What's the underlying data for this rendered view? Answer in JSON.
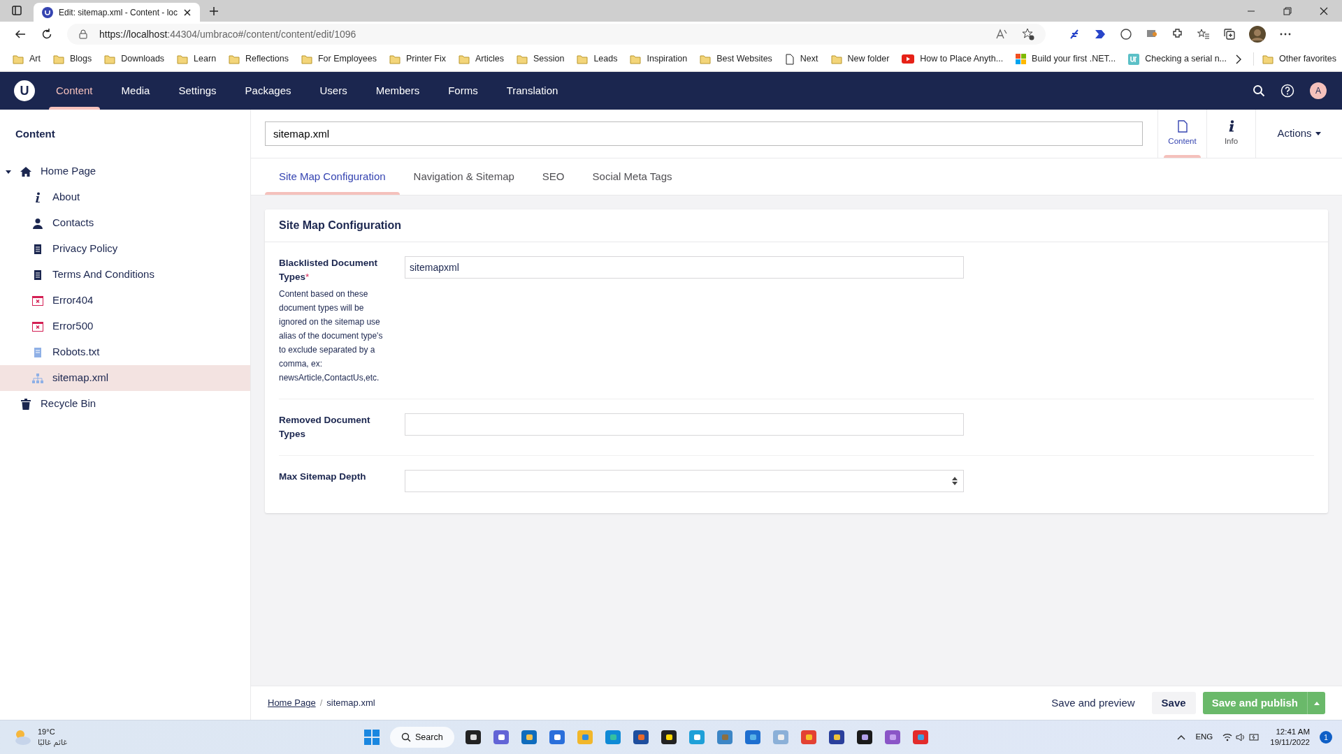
{
  "browser": {
    "tab_title": "Edit: sitemap.xml - Content - loc",
    "url_host": "https://localhost",
    "url_rest": ":44304/umbraco#/content/content/edit/1096",
    "bookmarks": [
      {
        "label": "Art",
        "kind": "folder"
      },
      {
        "label": "Blogs",
        "kind": "folder"
      },
      {
        "label": "Downloads",
        "kind": "folder"
      },
      {
        "label": "Learn",
        "kind": "folder"
      },
      {
        "label": "Reflections",
        "kind": "folder"
      },
      {
        "label": "For Employees",
        "kind": "folder"
      },
      {
        "label": "Printer Fix",
        "kind": "folder"
      },
      {
        "label": "Articles",
        "kind": "folder"
      },
      {
        "label": "Session",
        "kind": "folder"
      },
      {
        "label": "Leads",
        "kind": "folder"
      },
      {
        "label": "Inspiration",
        "kind": "folder"
      },
      {
        "label": "Best Websites",
        "kind": "folder"
      },
      {
        "label": "Next",
        "kind": "page"
      },
      {
        "label": "New folder",
        "kind": "folder"
      },
      {
        "label": "How to Place Anyth...",
        "kind": "video"
      },
      {
        "label": "Build your first .NET...",
        "kind": "tiles"
      },
      {
        "label": "Checking a serial n...",
        "kind": "up"
      }
    ],
    "other_favorites": "Other favorites"
  },
  "nav": {
    "logo": "U",
    "sections": [
      {
        "label": "Content",
        "selected": true
      },
      {
        "label": "Media",
        "selected": false
      },
      {
        "label": "Settings",
        "selected": false
      },
      {
        "label": "Packages",
        "selected": false
      },
      {
        "label": "Users",
        "selected": false
      },
      {
        "label": "Members",
        "selected": false
      },
      {
        "label": "Forms",
        "selected": false
      },
      {
        "label": "Translation",
        "selected": false
      }
    ],
    "avatar": "A"
  },
  "sidebar": {
    "title": "Content",
    "tree": [
      {
        "label": "Home Page",
        "kind": "home",
        "selected": false,
        "expanded": true,
        "children": [
          {
            "label": "About",
            "kind": "info",
            "selected": false
          },
          {
            "label": "Contacts",
            "kind": "person",
            "selected": false
          },
          {
            "label": "Privacy Policy",
            "kind": "doc",
            "selected": false
          },
          {
            "label": "Terms And Conditions",
            "kind": "doc",
            "selected": false
          },
          {
            "label": "Error404",
            "kind": "error",
            "selected": false
          },
          {
            "label": "Error500",
            "kind": "error",
            "selected": false
          },
          {
            "label": "Robots.txt",
            "kind": "file",
            "selected": false
          },
          {
            "label": "sitemap.xml",
            "kind": "sitemap",
            "selected": true
          }
        ]
      },
      {
        "label": "Recycle Bin",
        "kind": "trash",
        "selected": false
      }
    ]
  },
  "editor": {
    "name": "sitemap.xml",
    "apps": [
      {
        "label": "Content",
        "kind": "doc",
        "selected": true
      },
      {
        "label": "Info",
        "kind": "info",
        "selected": false
      }
    ],
    "actions": "Actions",
    "tabs": [
      {
        "label": "Site Map Configuration",
        "selected": true
      },
      {
        "label": "Navigation & Sitemap",
        "selected": false
      },
      {
        "label": "SEO",
        "selected": false
      },
      {
        "label": "Social Meta Tags",
        "selected": false
      }
    ],
    "group_title": "Site Map Configuration",
    "fields": [
      {
        "label": "Blacklisted Document Types",
        "required_mark": "*",
        "description": "Content based on these document types will be ignored on the sitemap use alias of the document type's to exclude separated by a comma, ex: newsArticle,ContactUs,etc.",
        "value": "sitemapxml",
        "kind": "text"
      },
      {
        "label": "Removed Document Types",
        "kind": "text"
      },
      {
        "label": "Max Sitemap Depth",
        "kind": "number"
      }
    ]
  },
  "footer": {
    "breadcrumb": [
      "Home Page",
      "sitemap.xml"
    ],
    "separator": "/",
    "save_preview": "Save and preview",
    "save": "Save",
    "publish": "Save and publish"
  },
  "taskbar": {
    "temperature": "19°C",
    "weather": "غائم غالبًا",
    "search": "Search",
    "language": "ENG",
    "time": "12:41 AM",
    "date": "19/11/2022",
    "notifications": "1"
  }
}
